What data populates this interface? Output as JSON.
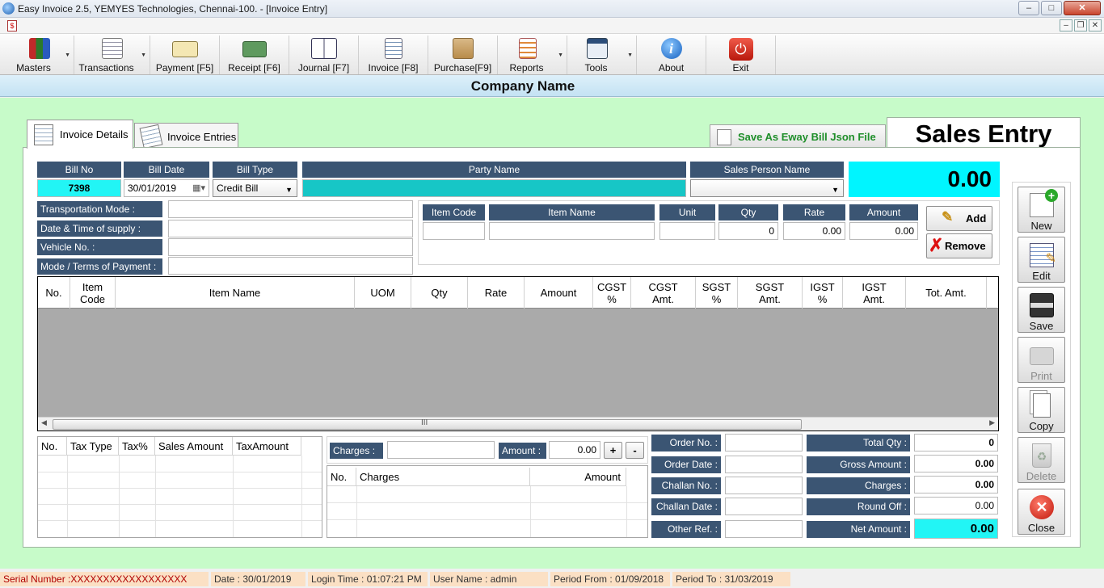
{
  "window": {
    "title": "Easy Invoice 2.5, YEMYES Technologies, Chennai-100. - [Invoice Entry]",
    "min": "–",
    "max": "□",
    "close": "✕",
    "mdi_min": "–",
    "mdi_restore": "❐",
    "mdi_close": "✕",
    "doc_icon": "$"
  },
  "toolbar": [
    {
      "label": "Masters",
      "icon": "books-icon",
      "dropdown": true
    },
    {
      "label": "Transactions",
      "icon": "notepad-pencil-icon",
      "dropdown": true
    },
    {
      "label": "Payment [F5]",
      "icon": "cheque-icon"
    },
    {
      "label": "Receipt [F6]",
      "icon": "cash-icon"
    },
    {
      "label": "Journal [F7]",
      "icon": "open-book-icon"
    },
    {
      "label": "Invoice [F8]",
      "icon": "invoice-sheet-icon"
    },
    {
      "label": "Purchase[F9]",
      "icon": "cart-boxes-icon"
    },
    {
      "label": "Reports",
      "icon": "report-icon",
      "dropdown": true
    },
    {
      "label": "Tools",
      "icon": "tools-window-icon",
      "dropdown": true
    },
    {
      "label": "About",
      "icon": "info-icon"
    },
    {
      "label": "Exit",
      "icon": "power-icon"
    }
  ],
  "company_name": "Company Name",
  "tabs": {
    "invoice_details": "Invoice Details",
    "invoice_entries": "Invoice Entries"
  },
  "eway_button": "Save As Eway Bill Json File",
  "heading": "Sales Entry",
  "bill": {
    "bill_no_label": "Bill No",
    "bill_no": "7398",
    "bill_date_label": "Bill Date",
    "bill_date": "30/01/2019",
    "bill_type_label": "Bill Type",
    "bill_type": "Credit Bill",
    "party_name_label": "Party Name",
    "party_name": "",
    "sales_person_label": "Sales Person Name",
    "sales_person": "",
    "total": "0.00"
  },
  "transport": {
    "mode_label": "Transportation Mode :",
    "datetime_label": "Date & Time of supply :",
    "vehicle_label": "Vehicle No. :",
    "payment_terms_label": "Mode / Terms of Payment :"
  },
  "item_entry": {
    "code_label": "Item Code",
    "name_label": "Item Name",
    "unit_label": "Unit",
    "qty_label": "Qty",
    "rate_label": "Rate",
    "amount_label": "Amount",
    "qty": "0",
    "rate": "0.00",
    "amount": "0.00",
    "add": "Add",
    "remove": "Remove"
  },
  "grid_columns": [
    {
      "l1": "No.",
      "l2": ""
    },
    {
      "l1": "Item",
      "l2": "Code"
    },
    {
      "l1": "Item Name",
      "l2": ""
    },
    {
      "l1": "UOM",
      "l2": ""
    },
    {
      "l1": "Qty",
      "l2": ""
    },
    {
      "l1": "Rate",
      "l2": ""
    },
    {
      "l1": "Amount",
      "l2": ""
    },
    {
      "l1": "CGST",
      "l2": "%"
    },
    {
      "l1": "CGST",
      "l2": "Amt."
    },
    {
      "l1": "SGST",
      "l2": "%"
    },
    {
      "l1": "SGST",
      "l2": "Amt."
    },
    {
      "l1": "IGST",
      "l2": "%"
    },
    {
      "l1": "IGST",
      "l2": "Amt."
    },
    {
      "l1": "Tot. Amt.",
      "l2": ""
    }
  ],
  "scroll_grip": "III",
  "tax_columns": [
    "No.",
    "Tax Type",
    "Tax%",
    "Sales Amount",
    "TaxAmount"
  ],
  "charges": {
    "label": "Charges :",
    "amount_label": "Amount :",
    "amount": "0.00",
    "plus": "+",
    "minus": "-",
    "columns": [
      "No.",
      "Charges",
      "Amount"
    ]
  },
  "order": {
    "order_no": "Order No. :",
    "order_date": "Order Date :",
    "challan_no": "Challan No. :",
    "challan_date": "Challan Date :",
    "other_ref": "Other Ref. :"
  },
  "totals": {
    "total_qty_label": "Total Qty :",
    "total_qty": "0",
    "gross_label": "Gross Amount :",
    "gross": "0.00",
    "charges_label": "Charges :",
    "charges": "0.00",
    "roundoff_label": "Round Off :",
    "roundoff": "0.00",
    "net_label": "Net Amount :",
    "net": "0.00"
  },
  "side_buttons": [
    {
      "label": "New",
      "icon": "new-doc-icon",
      "enabled": true
    },
    {
      "label": "Edit",
      "icon": "edit-doc-icon",
      "enabled": true
    },
    {
      "label": "Save",
      "icon": "floppy-icon",
      "enabled": true
    },
    {
      "label": "Print",
      "icon": "printer-icon",
      "enabled": false
    },
    {
      "label": "Copy",
      "icon": "copy-icon",
      "enabled": true
    },
    {
      "label": "Delete",
      "icon": "recycle-bin-icon",
      "enabled": false
    },
    {
      "label": "Close",
      "icon": "close-circle-icon",
      "enabled": true
    }
  ],
  "status": {
    "serial": "Serial Number :XXXXXXXXXXXXXXXXXX",
    "date": "Date : 30/01/2019",
    "login": "Login Time : 01:07:21 PM",
    "user": "User Name : admin",
    "period_from": "Period From : 01/09/2018",
    "period_to": "Period To : 31/03/2019"
  },
  "colors": {
    "header_navy": "#3b5573",
    "cyan": "#00f5ff",
    "green_bg": "#c7fbc9",
    "status_bg": "#fbe0c4",
    "eway_text": "#1f8f2a"
  }
}
